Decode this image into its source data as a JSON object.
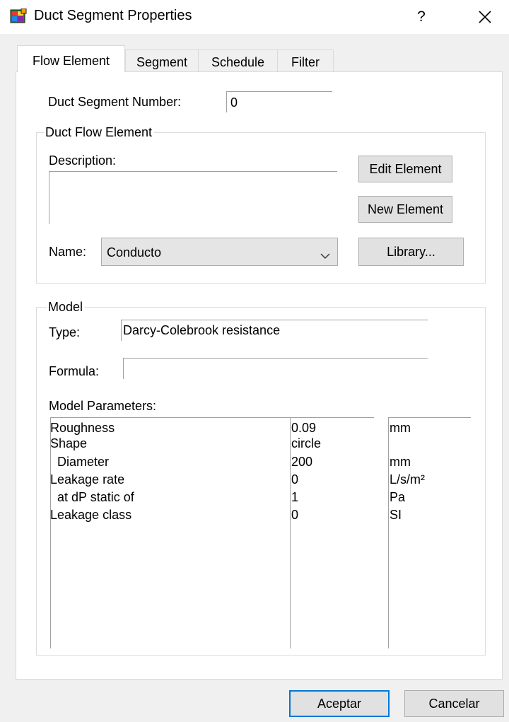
{
  "window": {
    "title": "Duct Segment Properties",
    "help_label": "?"
  },
  "tabs": [
    {
      "label": "Flow Element",
      "active": true
    },
    {
      "label": "Segment",
      "active": false
    },
    {
      "label": "Schedule",
      "active": false
    },
    {
      "label": "Filter",
      "active": false
    }
  ],
  "segment_number": {
    "label": "Duct Segment Number:",
    "value": "0"
  },
  "flow_element": {
    "group_title": "Duct Flow Element",
    "description_label": "Description:",
    "description_value": "",
    "name_label": "Name:",
    "name_value": "Conducto",
    "edit_button": "Edit Element",
    "new_button": "New Element",
    "library_button": "Library..."
  },
  "model": {
    "group_title": "Model",
    "type_label": "Type:",
    "type_value": "Darcy-Colebrook resistance",
    "formula_label": "Formula:",
    "formula_value": "",
    "params_label": "Model Parameters:",
    "params": [
      {
        "name": "Roughness",
        "value": "0.09",
        "unit": "mm"
      },
      {
        "name": "Shape",
        "value": "circle",
        "unit": ""
      },
      {
        "name": "  Diameter",
        "value": "200",
        "unit": "mm"
      },
      {
        "name": "Leakage rate",
        "value": "0",
        "unit": "L/s/m²"
      },
      {
        "name": "  at dP static of",
        "value": "1",
        "unit": "Pa"
      },
      {
        "name": "Leakage class",
        "value": "0",
        "unit": "SI"
      }
    ]
  },
  "footer": {
    "ok_button": "Aceptar",
    "cancel_button": "Cancelar"
  },
  "colors": {
    "accent": "#0078d7",
    "panel": "#ffffff",
    "window_bg": "#f0f0f0"
  }
}
